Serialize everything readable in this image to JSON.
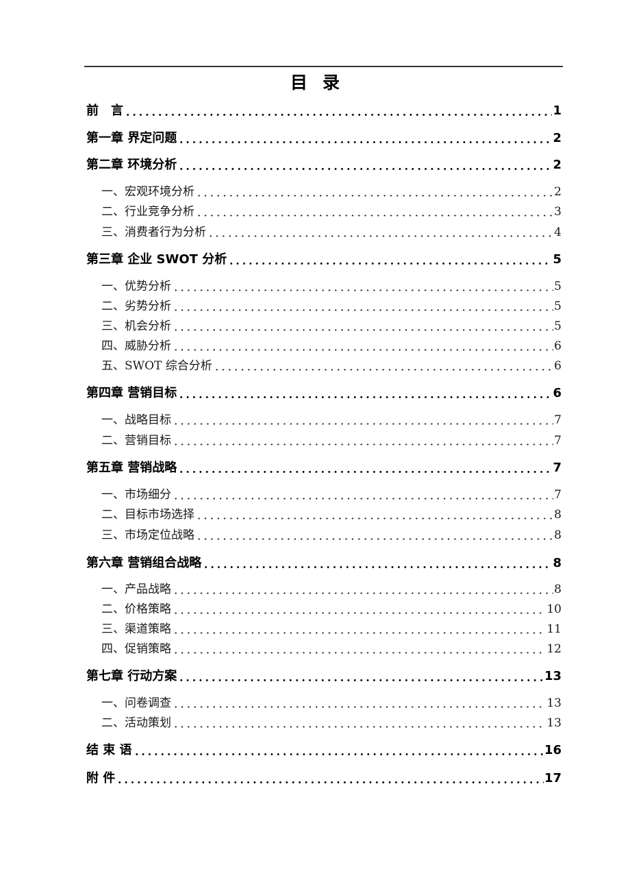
{
  "document": {
    "title_chars": [
      "目",
      "录"
    ],
    "entries": [
      {
        "level": "chapter",
        "label": "前　言",
        "page": "1"
      },
      {
        "level": "chapter",
        "label": "第一章 界定问题",
        "page": "2"
      },
      {
        "level": "chapter",
        "label": "第二章 环境分析",
        "page": "2"
      },
      {
        "level": "section",
        "label": "一、宏观环境分析",
        "page": "2"
      },
      {
        "level": "section",
        "label": "二、行业竞争分析",
        "page": "3"
      },
      {
        "level": "section",
        "label": "三、消费者行为分析",
        "page": "4"
      },
      {
        "level": "chapter",
        "label": "第三章 企业 SWOT 分析",
        "page": "5"
      },
      {
        "level": "section",
        "label": "一、优势分析",
        "page": "5"
      },
      {
        "level": "section",
        "label": "二、劣势分析",
        "page": "5"
      },
      {
        "level": "section",
        "label": "三、机会分析",
        "page": "5"
      },
      {
        "level": "section",
        "label": "四、威胁分析",
        "page": "6"
      },
      {
        "level": "section",
        "label": "五、SWOT 综合分析",
        "page": "6"
      },
      {
        "level": "chapter",
        "label": "第四章 营销目标",
        "page": "6"
      },
      {
        "level": "section",
        "label": "一、战略目标",
        "page": "7"
      },
      {
        "level": "section",
        "label": "二、营销目标",
        "page": "7"
      },
      {
        "level": "chapter",
        "label": "第五章 营销战略",
        "page": "7"
      },
      {
        "level": "section",
        "label": "一、市场细分",
        "page": "7"
      },
      {
        "level": "section",
        "label": "二、目标市场选择",
        "page": "8"
      },
      {
        "level": "section",
        "label": "三、市场定位战略",
        "page": "8"
      },
      {
        "level": "chapter",
        "label": "第六章 营销组合战略",
        "page": "8"
      },
      {
        "level": "section",
        "label": "一、产品战略",
        "page": "8"
      },
      {
        "level": "section",
        "label": "二、价格策略",
        "page": "10"
      },
      {
        "level": "section",
        "label": "三、渠道策略",
        "page": "11"
      },
      {
        "level": "section",
        "label": "四、促销策略",
        "page": "12"
      },
      {
        "level": "chapter",
        "label": "第七章 行动方案",
        "page": "13"
      },
      {
        "level": "section",
        "label": "一、问卷调查",
        "page": "13"
      },
      {
        "level": "section",
        "label": "二、活动策划",
        "page": "13"
      },
      {
        "level": "chapter",
        "label": "结 束 语",
        "page": "16"
      },
      {
        "level": "chapter",
        "label": "附 件",
        "page": "17"
      }
    ]
  }
}
